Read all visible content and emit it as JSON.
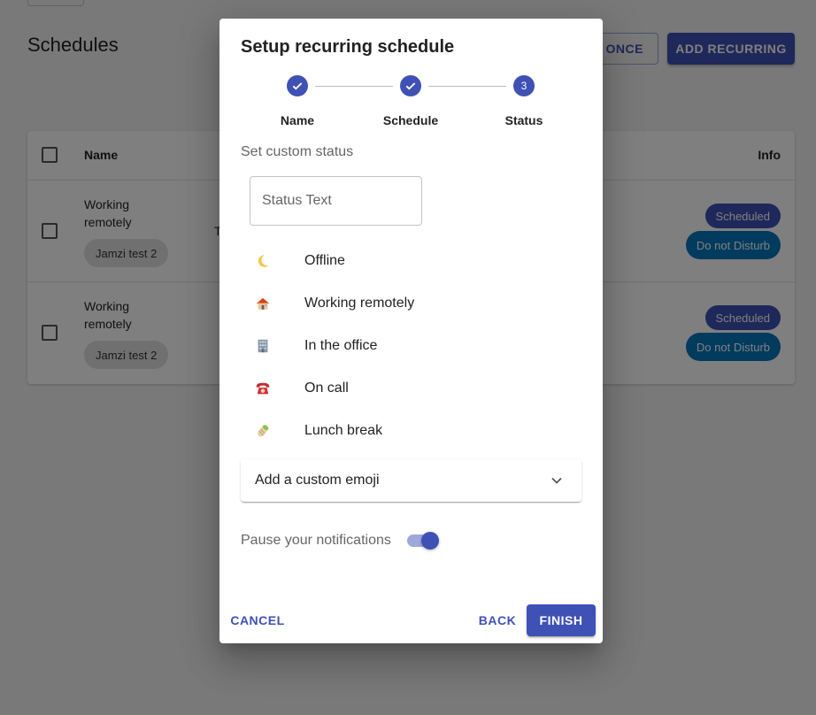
{
  "app": {
    "page_title": "Schedules",
    "buttons": {
      "add_once_partial": "D ONCE",
      "add_recurring": "ADD RECURRING"
    },
    "table": {
      "headers": {
        "name": "Name",
        "info": "Info"
      },
      "rows": [
        {
          "name": "Working remotely",
          "chip": "Jamzi test 2",
          "col2_partial": "T",
          "badges": [
            "Scheduled",
            "Do not Disturb"
          ]
        },
        {
          "name": "Working remotely",
          "chip": "Jamzi test 2",
          "col2_partial": "",
          "badges": [
            "Scheduled",
            "Do not Disturb"
          ]
        }
      ]
    }
  },
  "dialog": {
    "title": "Setup recurring schedule",
    "stepper": {
      "steps": [
        {
          "label": "Name",
          "state": "done"
        },
        {
          "label": "Schedule",
          "state": "done"
        },
        {
          "label": "Status",
          "state": "active",
          "number": "3"
        }
      ]
    },
    "custom_status_label": "Set custom status",
    "status_input": {
      "placeholder": "Status Text",
      "value": ""
    },
    "status_options": [
      {
        "emoji": "moon-icon",
        "label": "Offline"
      },
      {
        "emoji": "house-icon",
        "label": "Working remotely"
      },
      {
        "emoji": "office-building-icon",
        "label": "In the office"
      },
      {
        "emoji": "telephone-icon",
        "label": "On call"
      },
      {
        "emoji": "burrito-icon",
        "label": "Lunch break"
      }
    ],
    "custom_emoji_label": "Add a custom emoji",
    "pause_notifications": {
      "label": "Pause your notifications",
      "enabled": true
    },
    "actions": {
      "cancel": "CANCEL",
      "back": "BACK",
      "finish": "FINISH"
    }
  },
  "colors": {
    "primary": "#3f51b5",
    "primary_light": "#9fa8da",
    "dnd": "#0277bd",
    "backdrop": "rgba(0,0,0,0.5)"
  }
}
